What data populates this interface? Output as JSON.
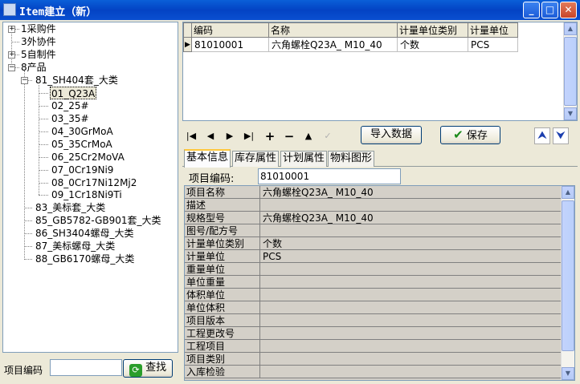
{
  "window": {
    "title": "Item建立（新）",
    "minimize_icon": "minimize-icon",
    "maximize_icon": "maximize-icon",
    "close_icon": "close-icon"
  },
  "tree": {
    "nodes": [
      {
        "label": "1采购件"
      },
      {
        "label": "3外协件"
      },
      {
        "label": "5自制件"
      },
      {
        "label": "8产品"
      },
      {
        "label": "81_SH404套_大类"
      },
      {
        "label": "01_Q23A"
      },
      {
        "label": "02_25#"
      },
      {
        "label": "03_35#"
      },
      {
        "label": "04_30GrMoA"
      },
      {
        "label": "05_35CrMoA"
      },
      {
        "label": "06_25Cr2MoVA"
      },
      {
        "label": "07_0Cr19Ni9"
      },
      {
        "label": "08_0Cr17Ni12Mj2"
      },
      {
        "label": "09_1Cr18Ni9Ti"
      },
      {
        "label": "83_美标套_大类"
      },
      {
        "label": "85_GB5782-GB901套_大类"
      },
      {
        "label": "86_SH3404螺母_大类"
      },
      {
        "label": "87_美标螺母_大类"
      },
      {
        "label": "88_GB6170螺母_大类"
      }
    ]
  },
  "search": {
    "label": "项目编码",
    "value": "",
    "button_label": "查找",
    "button_icon": "refresh-icon"
  },
  "grid": {
    "columns": [
      "编码",
      "名称",
      "计量单位类别",
      "计量单位"
    ],
    "rows": [
      {
        "code": "81010001",
        "name": "六角螺栓Q23A_ M10_40",
        "unit_category": "个数",
        "unit": "PCS"
      }
    ]
  },
  "toolbar": {
    "import_label": "导入数据",
    "save_label": "保存",
    "save_icon": "checkmark-icon",
    "up_icon": "arrow-up-icon",
    "down_icon": "arrow-down-icon",
    "nav_icons": [
      "first-record-icon",
      "prev-record-icon",
      "next-record-icon",
      "last-record-icon",
      "add-record-icon",
      "delete-record-icon",
      "edit-record-icon",
      "post-record-icon"
    ]
  },
  "tabs": [
    {
      "label": "基本信息",
      "active": true
    },
    {
      "label": "库存属性",
      "active": false
    },
    {
      "label": "计划属性",
      "active": false
    },
    {
      "label": "物料图形",
      "active": false
    }
  ],
  "item_code": {
    "label": "项目编码:",
    "value": "81010001"
  },
  "properties": [
    {
      "key": "项目名称",
      "value": "六角螺栓Q23A_ M10_40"
    },
    {
      "key": "描述",
      "value": ""
    },
    {
      "key": "规格型号",
      "value": "六角螺栓Q23A_ M10_40"
    },
    {
      "key": "图号/配方号",
      "value": ""
    },
    {
      "key": "计量单位类别",
      "value": "个数"
    },
    {
      "key": "计量单位",
      "value": "PCS"
    },
    {
      "key": "重量单位",
      "value": ""
    },
    {
      "key": "单位重量",
      "value": ""
    },
    {
      "key": "体积单位",
      "value": ""
    },
    {
      "key": "单位体积",
      "value": ""
    },
    {
      "key": "项目版本",
      "value": ""
    },
    {
      "key": "工程更改号",
      "value": ""
    },
    {
      "key": "工程项目",
      "value": ""
    },
    {
      "key": "项目类别",
      "value": ""
    },
    {
      "key": "入库检验",
      "value": ""
    }
  ]
}
